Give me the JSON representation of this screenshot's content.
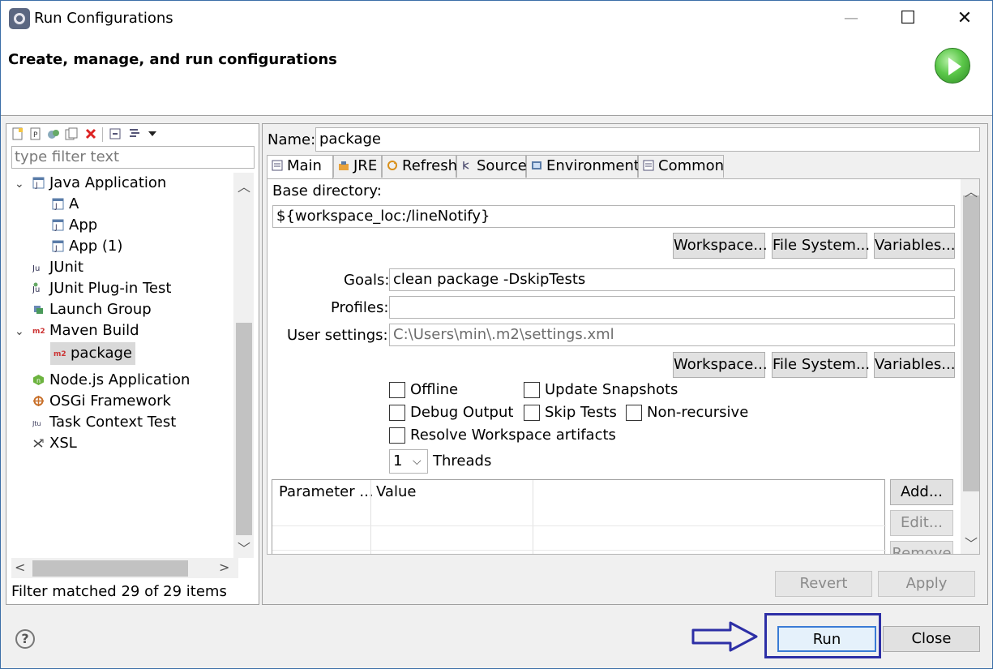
{
  "window": {
    "title": "Run Configurations",
    "minimize_glyph": "—",
    "maximize_glyph": "☐",
    "close_glyph": "✕"
  },
  "header": {
    "title": "Create, manage, and run configurations"
  },
  "left_panel": {
    "filter_placeholder": "type filter text",
    "tree": [
      {
        "label": "Java Application",
        "icon": "java-app-icon",
        "expanded": true
      },
      {
        "label": "A",
        "icon": "java-config-icon"
      },
      {
        "label": "App",
        "icon": "java-config-icon"
      },
      {
        "label": "App (1)",
        "icon": "java-config-icon"
      },
      {
        "label": "JUnit",
        "icon": "junit-icon"
      },
      {
        "label": "JUnit Plug-in Test",
        "icon": "junit-plugin-icon"
      },
      {
        "label": "Launch Group",
        "icon": "launch-group-icon"
      },
      {
        "label": "Maven Build",
        "icon": "maven-icon",
        "expanded": true
      },
      {
        "label": "package",
        "icon": "maven-icon",
        "selected": true
      },
      {
        "label": "Node.js Application",
        "icon": "nodejs-icon"
      },
      {
        "label": "OSGi Framework",
        "icon": "osgi-icon"
      },
      {
        "label": "Task Context Test",
        "icon": "task-context-icon"
      },
      {
        "label": "XSL",
        "icon": "xsl-icon"
      }
    ],
    "status": "Filter matched 29 of 29 items",
    "maven_icon_text": "m2",
    "junit_icon_text": "Ju",
    "task_icon_text": "Jtu"
  },
  "config": {
    "name_label": "Name:",
    "name_value": "package",
    "tabs": [
      "Main",
      "JRE",
      "Refresh",
      "Source",
      "Environment",
      "Common"
    ],
    "base_dir_label": "Base directory:",
    "base_dir_value": "${workspace_loc:/lineNotify}",
    "workspace_btn": "Workspace...",
    "filesystem_btn": "File System...",
    "variables_btn": "Variables...",
    "goals_label": "Goals:",
    "goals_value": "clean package -DskipTests",
    "profiles_label": "Profiles:",
    "profiles_value": "",
    "user_settings_label": "User settings:",
    "user_settings_value": "C:\\Users\\min\\.m2\\settings.xml",
    "checkboxes": {
      "offline": "Offline",
      "update_snapshots": "Update Snapshots",
      "debug_output": "Debug Output",
      "skip_tests": "Skip Tests",
      "non_recursive": "Non-recursive",
      "resolve_workspace": "Resolve Workspace artifacts"
    },
    "threads_value": "1",
    "threads_label": "Threads",
    "table_headers": [
      "Parameter ...",
      "Value"
    ],
    "add_btn": "Add...",
    "edit_btn": "Edit...",
    "remove_btn": "Remove"
  },
  "actions": {
    "revert": "Revert",
    "apply": "Apply",
    "run": "Run",
    "close": "Close",
    "help": "?"
  },
  "colors": {
    "highlight": "#2d2fa6",
    "run_badge": "#5cc84a"
  }
}
